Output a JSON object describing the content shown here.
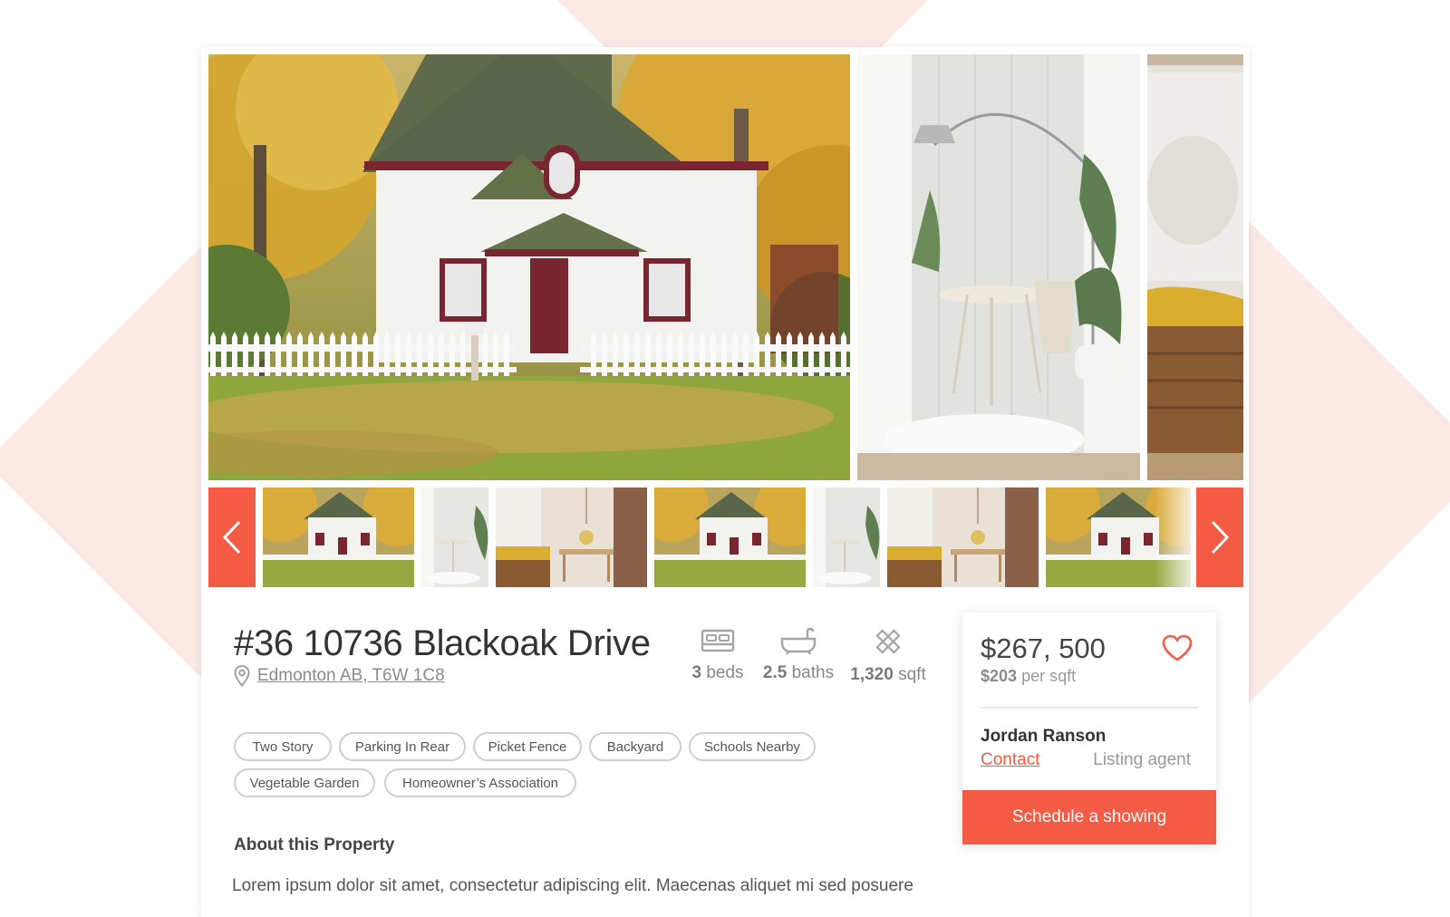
{
  "listing": {
    "title": "#36 10736 Blackoak Drive",
    "address": "Edmonton AB, T6W 1C8"
  },
  "stats": {
    "beds_value": "3",
    "beds_unit": "beds",
    "baths_value": "2.5",
    "baths_unit": "baths",
    "sqft_value": "1,320",
    "sqft_unit": "sqft"
  },
  "tags": [
    "Two Story",
    "Parking In Rear",
    "Picket Fence",
    "Backyard",
    "Schools Nearby",
    "Vegetable Garden",
    "Homeowner’s Association"
  ],
  "about": {
    "heading": "About this Property",
    "text": "Lorem ipsum dolor sit amet, consectetur adipiscing elit. Maecenas aliquet mi sed posuere"
  },
  "pricing": {
    "price": "$267, 500",
    "per_sqft_value": "$203",
    "per_sqft_label": "per sqft"
  },
  "agent": {
    "name": "Jordan Ranson",
    "contact_label": "Contact",
    "role": "Listing agent",
    "cta_label": "Schedule a showing"
  },
  "gallery": {
    "prev_icon": "chevron-left-icon",
    "next_icon": "chevron-right-icon"
  },
  "colors": {
    "accent": "#f45b45",
    "background_shape": "#fbe9e5"
  }
}
